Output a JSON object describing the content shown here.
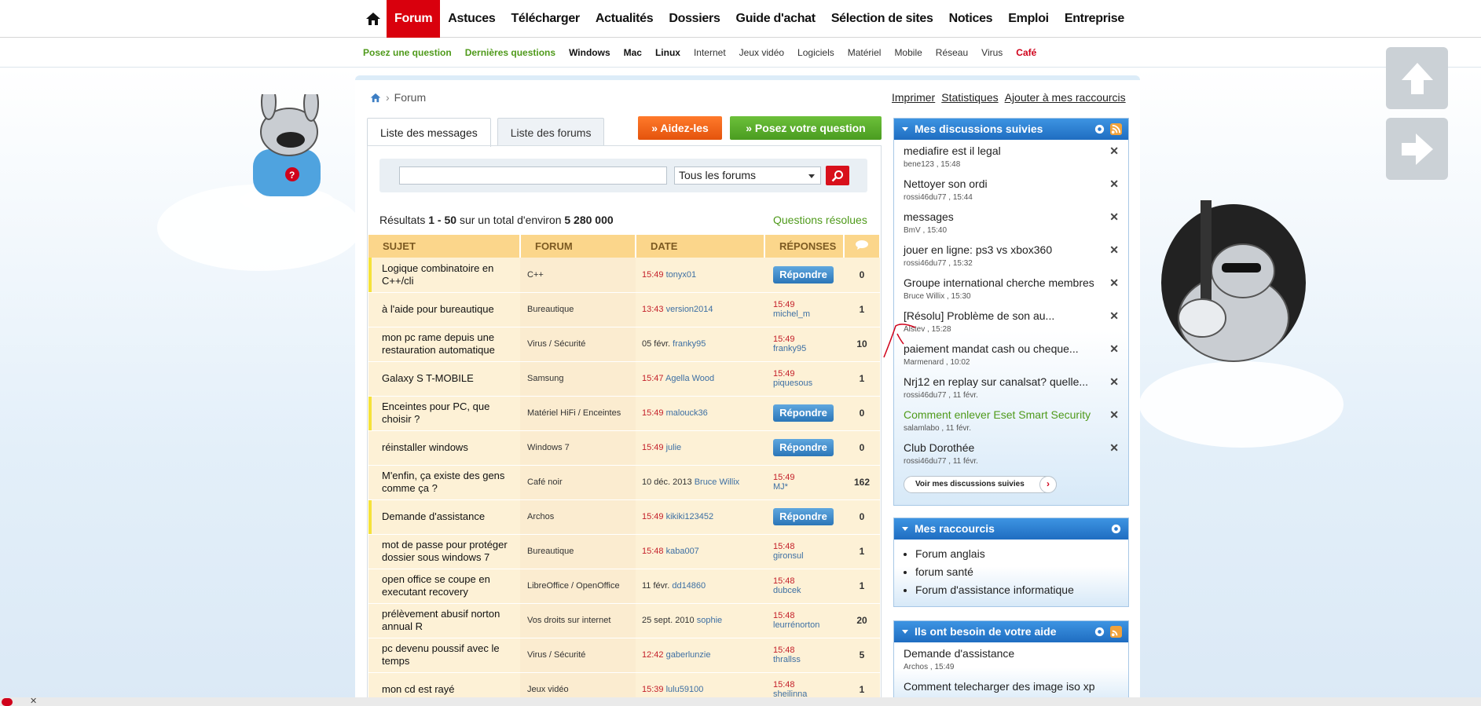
{
  "nav": {
    "items": [
      {
        "label": "Forum",
        "active": true
      },
      {
        "label": "Astuces"
      },
      {
        "label": "Télécharger"
      },
      {
        "label": "Actualités"
      },
      {
        "label": "Dossiers"
      },
      {
        "label": "Guide d'achat"
      },
      {
        "label": "Sélection de sites"
      },
      {
        "label": "Notices"
      },
      {
        "label": "Emploi"
      },
      {
        "label": "Entreprise"
      }
    ],
    "sub": [
      {
        "label": "Posez une question",
        "style": "green"
      },
      {
        "label": "Dernières questions",
        "style": "green"
      },
      {
        "label": "Windows",
        "style": "bold"
      },
      {
        "label": "Mac",
        "style": "bold"
      },
      {
        "label": "Linux",
        "style": "bold"
      },
      {
        "label": "Internet"
      },
      {
        "label": "Jeux vidéo"
      },
      {
        "label": "Logiciels"
      },
      {
        "label": "Matériel"
      },
      {
        "label": "Mobile"
      },
      {
        "label": "Réseau"
      },
      {
        "label": "Virus"
      },
      {
        "label": "Café",
        "style": "red"
      }
    ]
  },
  "breadcrumb": {
    "sep": "›",
    "current": "Forum"
  },
  "toplinks": [
    "Imprimer",
    "Statistiques",
    "Ajouter à mes raccourcis"
  ],
  "tabs": [
    "Liste des messages",
    "Liste des forums"
  ],
  "buttons": {
    "help": "» Aidez-les",
    "ask": "» Posez votre question"
  },
  "search": {
    "value": "",
    "scope": "Tous les forums"
  },
  "results": {
    "prefix": "Résultats ",
    "range": "1 - 50",
    "middle": " sur un total d'environ ",
    "total": "5 280 000"
  },
  "resolved_link": "Questions résolues",
  "table": {
    "headers": [
      "SUJET",
      "FORUM",
      "DATE",
      "RÉPONSES"
    ],
    "rows": [
      {
        "subject": "Logique combinatoire en C++/cli",
        "forum": "C++",
        "time": "15:49",
        "user": "tonyx01",
        "reply": "Répondre",
        "count": "0",
        "hl": true
      },
      {
        "subject": "à l'aide pour bureautique",
        "forum": "Bureautique",
        "time": "13:43",
        "user": "version2014",
        "rtime": "15:49",
        "ruser": "michel_m",
        "count": "1"
      },
      {
        "subject": "mon pc rame depuis une restauration automatique",
        "forum": "Virus / Sécurité",
        "date": "05 févr.",
        "user": "franky95",
        "rtime": "15:49",
        "ruser": "franky95",
        "count": "10"
      },
      {
        "subject": "Galaxy S T-MOBILE",
        "forum": "Samsung",
        "time": "15:47",
        "user": "Agella Wood",
        "rtime": "15:49",
        "ruser": "piquesous",
        "count": "1"
      },
      {
        "subject": "Enceintes pour PC, que choisir ?",
        "forum": "Matériel HiFi / Enceintes",
        "time": "15:49",
        "user": "malouck36",
        "reply": "Répondre",
        "count": "0",
        "hl": true
      },
      {
        "subject": "réinstaller windows",
        "forum": "Windows 7",
        "time": "15:49",
        "user": "julie",
        "reply": "Répondre",
        "count": "0"
      },
      {
        "subject": "M'enfin, ça existe des gens comme ça ?",
        "forum": "Café noir",
        "date": "10 déc. 2013",
        "user": "Bruce Willix",
        "rtime": "15:49",
        "ruser": "MJ*",
        "count": "162"
      },
      {
        "subject": "Demande d'assistance",
        "forum": "Archos",
        "time": "15:49",
        "user": "kikiki123452",
        "reply": "Répondre",
        "count": "0",
        "hl": true
      },
      {
        "subject": "mot de passe pour protéger dossier sous windows 7",
        "forum": "Bureautique",
        "time": "15:48",
        "user": "kaba007",
        "rtime": "15:48",
        "ruser": "gironsul",
        "count": "1"
      },
      {
        "subject": "open office se coupe en executant recovery",
        "forum": "LibreOffice / OpenOffice",
        "date": "11 févr.",
        "user": "dd14860",
        "rtime": "15:48",
        "ruser": "dubcek",
        "count": "1"
      },
      {
        "subject": "prélèvement abusif norton annual R",
        "forum": "Vos droits sur internet",
        "date": "25 sept. 2010",
        "user": "sophie",
        "rtime": "15:48",
        "ruser": "leurrénorton",
        "count": "20"
      },
      {
        "subject": "pc devenu poussif avec le temps",
        "forum": "Virus / Sécurité",
        "time": "12:42",
        "user": "gaberlunzie",
        "rtime": "15:48",
        "ruser": "thrallss",
        "count": "5"
      },
      {
        "subject": "mon cd est rayé",
        "forum": "Jeux vidéo",
        "time": "15:39",
        "user": "lulu59100",
        "rtime": "15:48",
        "ruser": "sheilinna",
        "count": "1"
      }
    ]
  },
  "followed": {
    "title": "Mes discussions suivies",
    "items": [
      {
        "t": "mediafire est il legal",
        "m": "bene123 , 15:48"
      },
      {
        "t": "Nettoyer son ordi",
        "m": "rossi46du77 , 15:44"
      },
      {
        "t": "messages",
        "m": "BmV , 15:40"
      },
      {
        "t": "jouer en ligne: ps3 vs xbox360",
        "m": "rossi46du77 , 15:32"
      },
      {
        "t": "Groupe international cherche membres",
        "m": "Bruce Willix , 15:30"
      },
      {
        "t": "[Résolu] Problème de son au...",
        "m": "Alstev , 15:28"
      },
      {
        "t": "paiement mandat cash ou cheque...",
        "m": "Marmenard , 10:02"
      },
      {
        "t": "Nrj12 en replay sur canalsat? quelle...",
        "m": "rossi46du77 , 11 févr."
      },
      {
        "t": "Comment enlever Eset Smart Security",
        "m": "salamlabo , 11 févr.",
        "green": true
      },
      {
        "t": "Club Dorothée",
        "m": "rossi46du77 , 11 févr."
      }
    ],
    "see_all": "Voir mes discussions suivies"
  },
  "shortcuts": {
    "title": "Mes raccourcis",
    "items": [
      "Forum anglais",
      "forum santé",
      "Forum d'assistance informatique"
    ]
  },
  "need_help": {
    "title": "Ils ont besoin de votre aide",
    "items": [
      {
        "t": "Demande d'assistance",
        "m": "Archos , 15:49"
      },
      {
        "t": "Comment telecharger des image iso xp",
        "m": ""
      }
    ]
  },
  "colors": {
    "brand_red": "#d9000d",
    "accent_blue": "#1f6dc1",
    "green": "#4f9a1b"
  }
}
